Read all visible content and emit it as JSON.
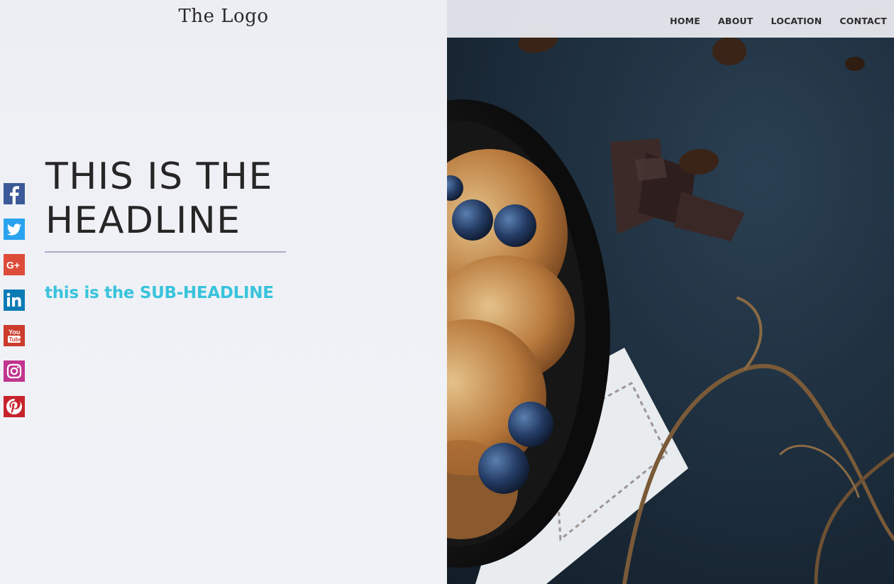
{
  "header": {
    "logo": "The Logo",
    "nav": [
      "HOME",
      "ABOUT",
      "LOCATION",
      "CONTACT"
    ]
  },
  "hero": {
    "headline_line1": "THIS IS THE",
    "headline_line2": "HEADLINE",
    "subheadline": "this is the SUB-HEADLINE"
  },
  "social": [
    {
      "name": "facebook-icon",
      "color": "#3b5998"
    },
    {
      "name": "twitter-icon",
      "color": "#2aa3ef"
    },
    {
      "name": "google-plus-icon",
      "color": "#dd4b39"
    },
    {
      "name": "linkedin-icon",
      "color": "#0b7bb6"
    },
    {
      "name": "youtube-icon",
      "color": "#cc3b2c"
    },
    {
      "name": "instagram-icon",
      "color": "#c1358e"
    },
    {
      "name": "pinterest-icon",
      "color": "#c8232c"
    }
  ],
  "colors": {
    "accent": "#39c3dc",
    "text": "#262626",
    "rule": "#a9adc8",
    "panel_bg": "#eef0f5"
  }
}
